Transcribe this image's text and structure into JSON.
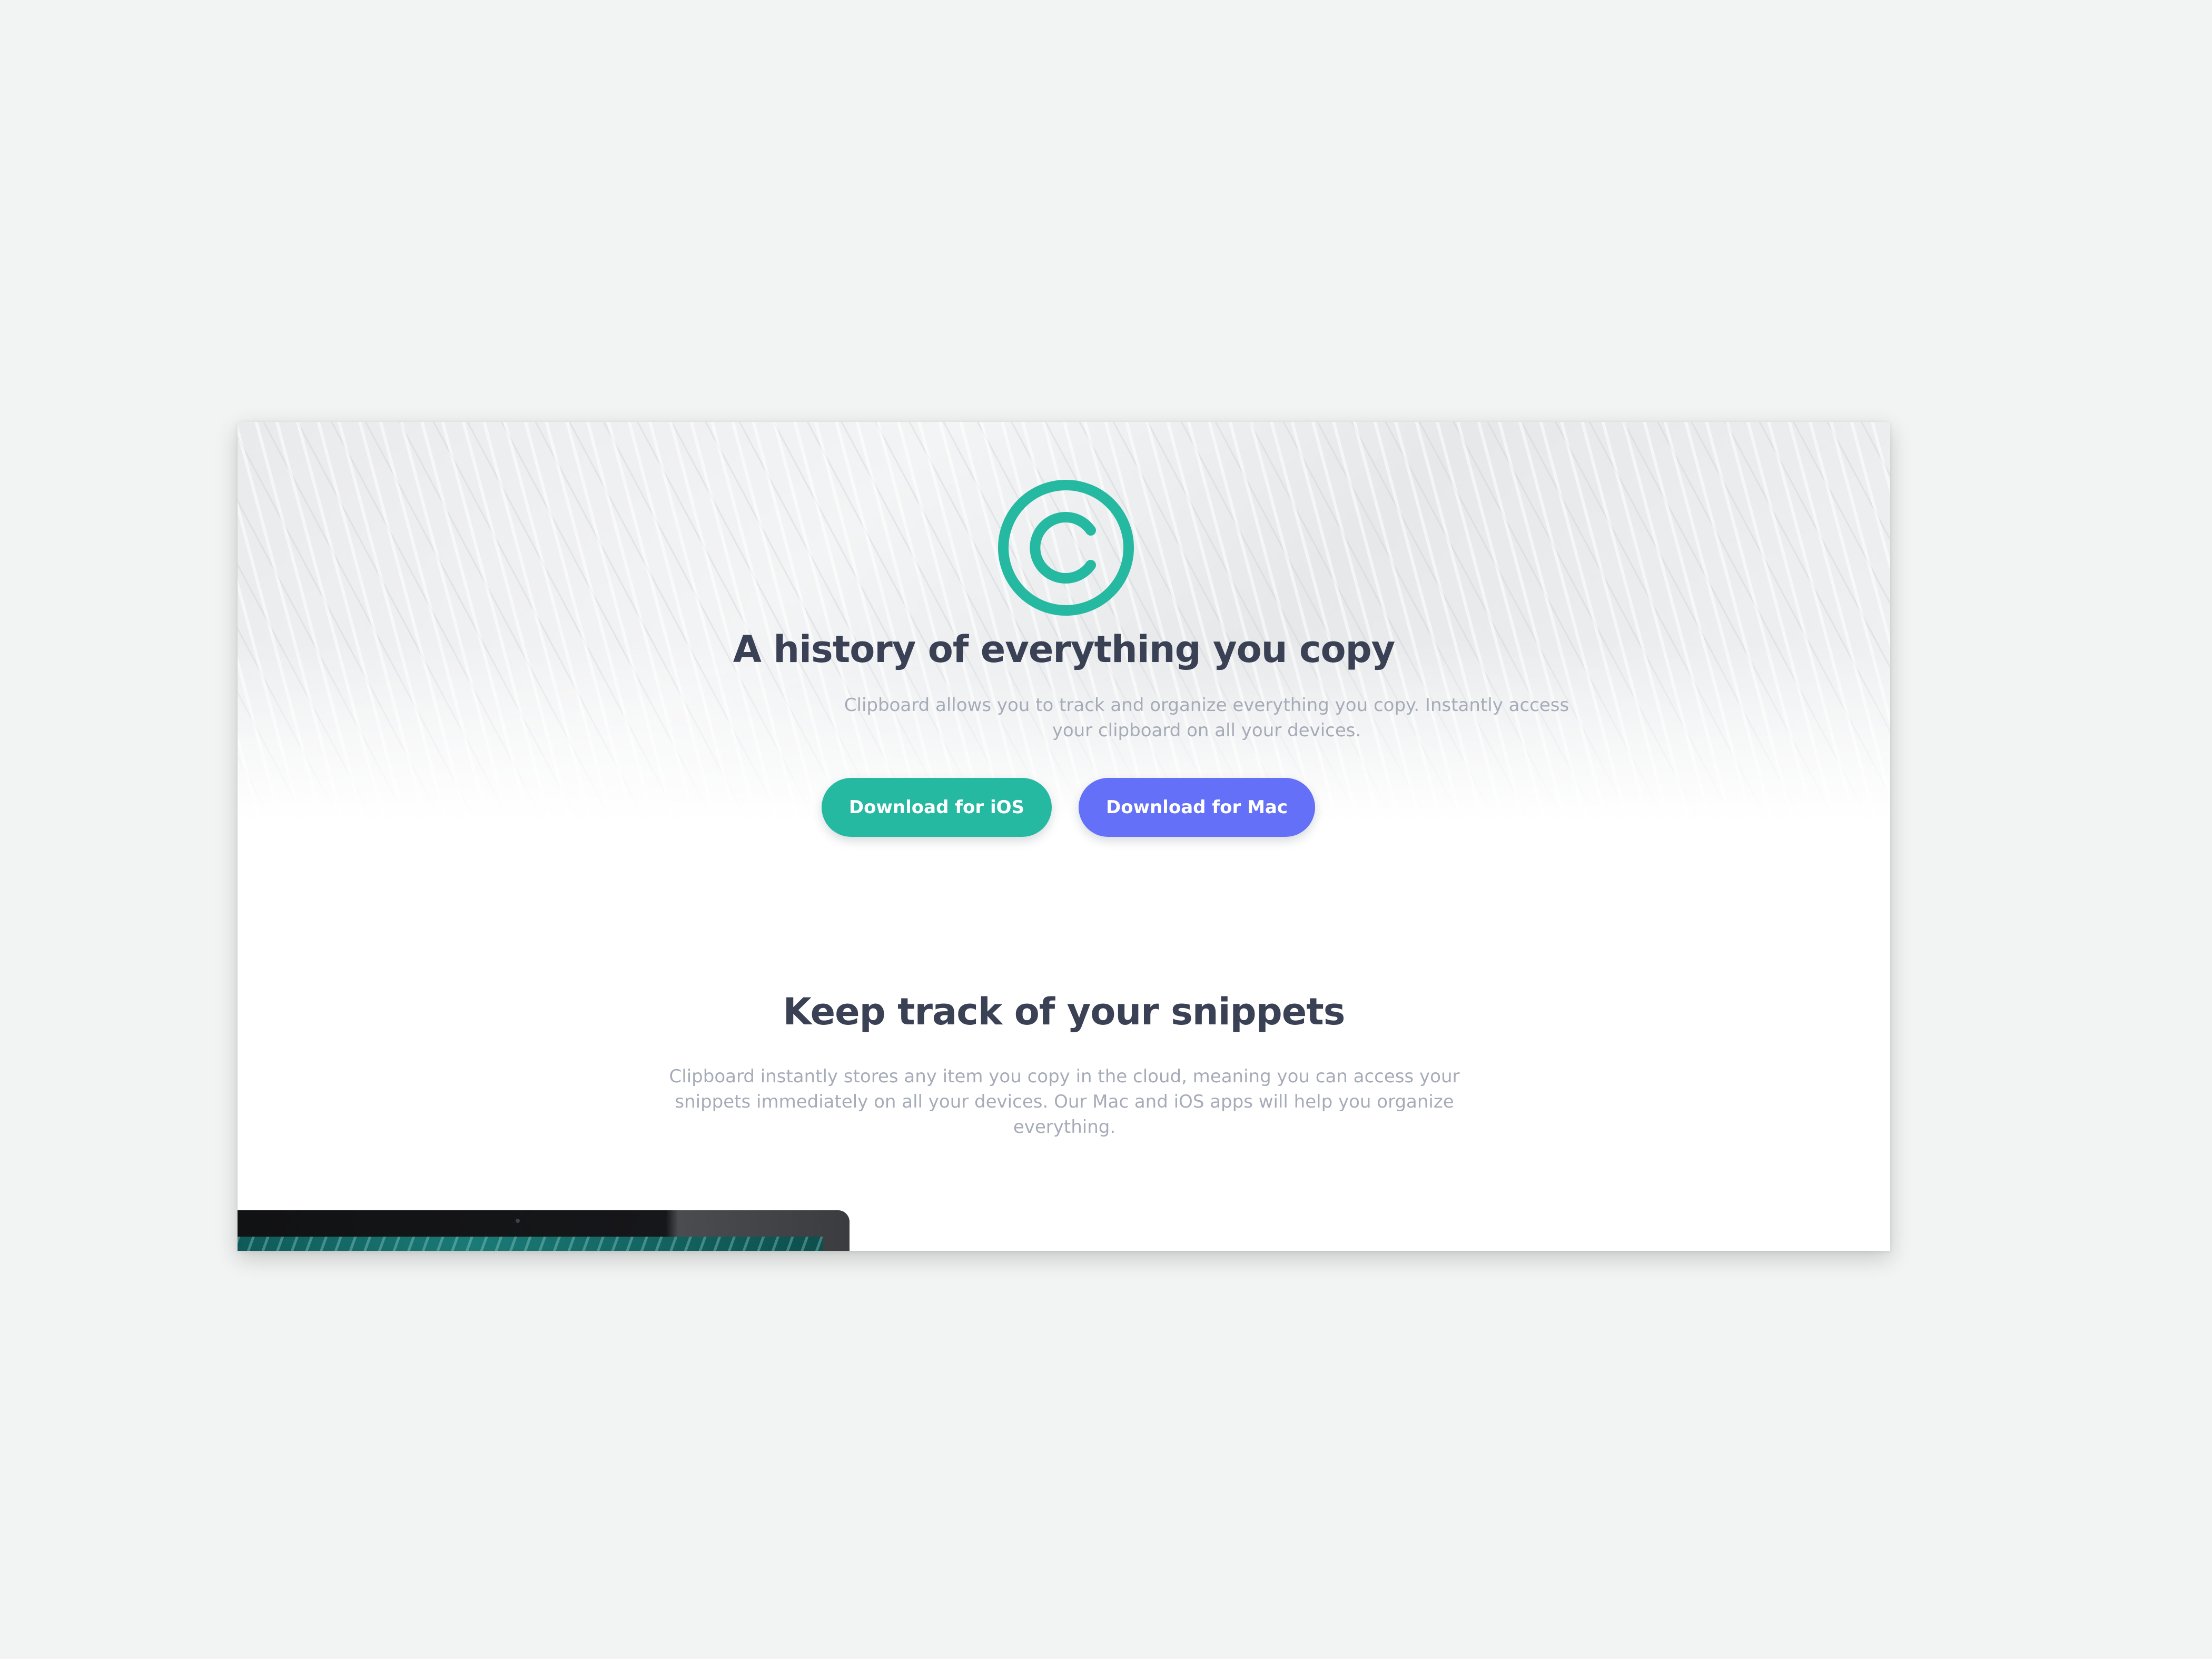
{
  "colors": {
    "page_background": "#f2f4f3",
    "heading": "#3a4155",
    "body_text": "#a6abb8",
    "ios_button": "#26b9a2",
    "mac_button": "#6370f7",
    "logo": "#26b9a2"
  },
  "hero": {
    "logo_icon": "copyright-c-icon",
    "title": "A history of everything you copy",
    "subtitle": "Clipboard allows you to track and organize everything you copy. Instantly access your clipboard on all your devices.",
    "ios_button_label": "Download for iOS",
    "mac_button_label": "Download for Mac"
  },
  "snippets_section": {
    "title": "Keep track of your snippets",
    "text": "Clipboard instantly stores any item you copy in the cloud, meaning you can access your snippets immediately on all your devices. Our Mac and iOS apps will help you organize everything."
  }
}
